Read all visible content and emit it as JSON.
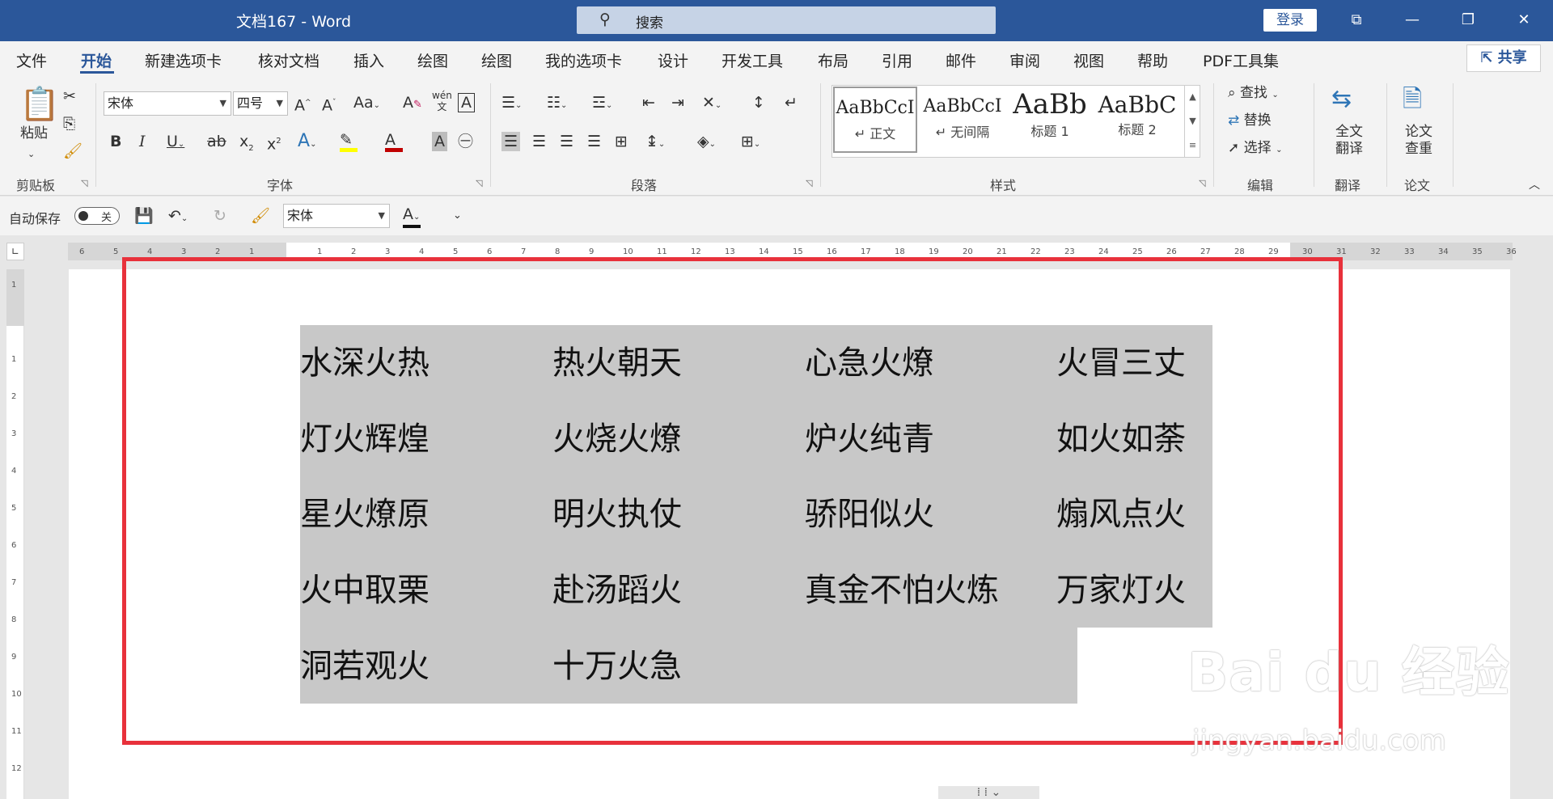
{
  "window": {
    "title": "文档167  -  Word",
    "search_placeholder": "搜索",
    "login_label": "登录",
    "controls": [
      "⧉",
      "—",
      "❐",
      "✕"
    ]
  },
  "menu": {
    "tabs": [
      "文件",
      "开始",
      "新建选项卡",
      "核对文档",
      "插入",
      "绘图",
      "绘图",
      "我的选项卡",
      "设计",
      "开发工具",
      "布局",
      "引用",
      "邮件",
      "审阅",
      "视图",
      "帮助",
      "PDF工具集"
    ],
    "active_tab": "开始",
    "share_label": "共享"
  },
  "ribbon": {
    "clipboard": {
      "paste_label": "粘贴",
      "group_label": "剪贴板"
    },
    "font": {
      "font_name": "宋体",
      "font_size": "四号",
      "group_label": "字体",
      "font_color": "#c00000",
      "highlight_color": "#ffff00"
    },
    "paragraph": {
      "group_label": "段落"
    },
    "styles": {
      "group_label": "样式",
      "items": [
        {
          "preview": "AaBbCcI",
          "name": "↵ 正文"
        },
        {
          "preview": "AaBbCcI",
          "name": "↵ 无间隔"
        },
        {
          "preview": "AaBb",
          "name": "标题 1"
        },
        {
          "preview": "AaBbC",
          "name": "标题 2"
        }
      ]
    },
    "editing": {
      "find_label": "查找",
      "replace_label": "替换",
      "select_label": "选择",
      "group_label": "编辑"
    },
    "translate": {
      "button_label_1": "全文",
      "button_label_2": "翻译",
      "group_label": "翻译"
    },
    "paper": {
      "button_label_1": "论文",
      "button_label_2": "查重",
      "group_label": "论文"
    }
  },
  "qat": {
    "autosave_label": "自动保存",
    "autosave_state": "关",
    "font_name": "宋体"
  },
  "ruler": {
    "ticks": [
      "6",
      "5",
      "4",
      "3",
      "2",
      "1",
      "",
      "1",
      "2",
      "3",
      "4",
      "5",
      "6",
      "7",
      "8",
      "9",
      "10",
      "11",
      "12",
      "13",
      "14",
      "15",
      "16",
      "17",
      "18",
      "19",
      "20",
      "21",
      "22",
      "23",
      "24",
      "25",
      "26",
      "27",
      "28",
      "29",
      "30",
      "31",
      "32",
      "33",
      "34",
      "35",
      "36"
    ],
    "vticks": [
      "1",
      "",
      "1",
      "2",
      "3",
      "4",
      "5",
      "6",
      "7",
      "8",
      "9",
      "10",
      "11",
      "12"
    ]
  },
  "document": {
    "rows": [
      [
        "水深火热",
        "热火朝天",
        "心急火燎",
        "火冒三丈"
      ],
      [
        "灯火辉煌",
        "火烧火燎",
        "炉火纯青",
        "如火如荼"
      ],
      [
        "星火燎原",
        "明火执仗",
        "骄阳似火",
        "煽风点火"
      ],
      [
        "火中取栗",
        "赴汤蹈火",
        "真金不怕火炼",
        "万家灯火"
      ],
      [
        "洞若观火",
        "十万火急"
      ]
    ]
  },
  "watermark": {
    "brand": "Bai du 经验",
    "url": "jingyan.baidu.com"
  },
  "colors": {
    "accent": "#2b579a",
    "highlight_frame": "#e8313b",
    "selection": "#c8c8c8"
  }
}
